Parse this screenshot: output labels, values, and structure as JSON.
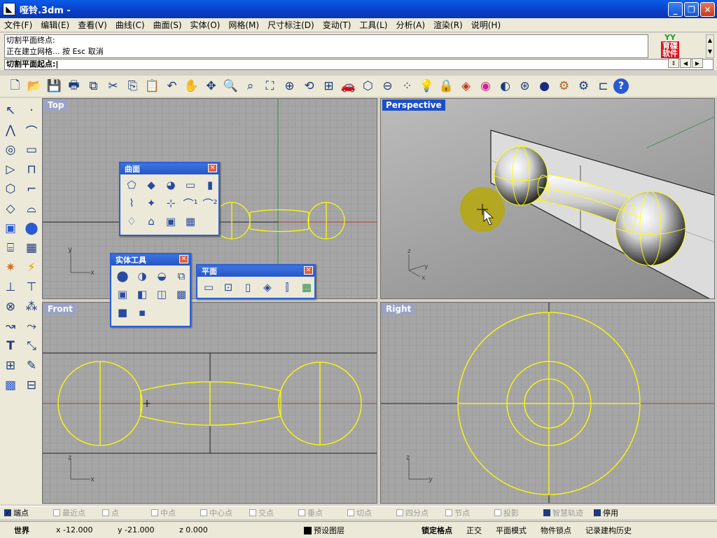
{
  "window": {
    "title": "哑铃.3dm -",
    "icon": "rhino-app-icon"
  },
  "menu": [
    "文件(F)",
    "编辑(E)",
    "查看(V)",
    "曲线(C)",
    "曲面(S)",
    "实体(O)",
    "网格(M)",
    "尺寸标注(D)",
    "变动(T)",
    "工具(L)",
    "分析(A)",
    "渲染(R)",
    "说明(H)"
  ],
  "command": {
    "history": [
      "切割平面终点:",
      "正在建立网格... 按 Esc 取消"
    ],
    "prompt": "切割平面起点:"
  },
  "logo": {
    "top": "YY",
    "line1": "育碟",
    "line2": "软件"
  },
  "viewports": {
    "top": "Top",
    "perspective": "Perspective",
    "front": "Front",
    "right": "Right"
  },
  "panels": {
    "surface": "曲面",
    "solid": "实体工具",
    "plane": "平面"
  },
  "osnaps": [
    {
      "label": "端点",
      "on": true
    },
    {
      "label": "最近点",
      "on": false
    },
    {
      "label": "点",
      "on": false
    },
    {
      "label": "中点",
      "on": false
    },
    {
      "label": "中心点",
      "on": false
    },
    {
      "label": "交点",
      "on": false
    },
    {
      "label": "垂点",
      "on": false
    },
    {
      "label": "切点",
      "on": false
    },
    {
      "label": "四分点",
      "on": false
    },
    {
      "label": "节点",
      "on": false
    },
    {
      "label": "投影",
      "on": false
    },
    {
      "label": "智慧轨迹",
      "on": false
    },
    {
      "label": "停用",
      "on": true
    }
  ],
  "status": {
    "cplane": "世界",
    "x": "x -12.000",
    "y": "y -21.000",
    "z": "z 0.000",
    "layer": "预设图层",
    "grid_snap": "锁定格点",
    "ortho": "正交",
    "planar": "平面模式",
    "osnap": "物件锁点",
    "history": "记录建构历史"
  },
  "colors": {
    "curve": "#ffff00",
    "title_bar": "#0a5ce8",
    "active_label": "#1c4fc8"
  }
}
